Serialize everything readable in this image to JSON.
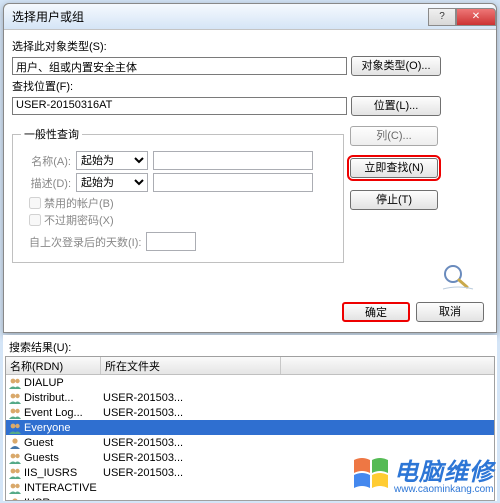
{
  "titlebar": {
    "text": "选择用户或组"
  },
  "labels": {
    "object_type": "选择此对象类型(S):",
    "object_type_val": "用户、组或内置安全主体",
    "object_type_btn": "对象类型(O)...",
    "location": "查找位置(F):",
    "location_val": "USER-20150316AT",
    "location_btn": "位置(L)...",
    "general_query": "一般性查询",
    "name": "名称(A):",
    "desc": "描述(D):",
    "starts_with": "起始为",
    "disabled_acct": "禁用的帐户(B)",
    "no_expire": "不过期密码(X)",
    "days_since": "自上次登录后的天数(I):",
    "columns_btn": "列(C)...",
    "find_now_btn": "立即查找(N)",
    "stop_btn": "停止(T)",
    "ok_btn": "确定",
    "cancel_btn": "取消",
    "results": "搜索结果(U):",
    "col_name": "名称(RDN)",
    "col_folder": "所在文件夹"
  },
  "results": [
    {
      "name": "DIALUP",
      "folder": "",
      "type": "group"
    },
    {
      "name": "Distribut...",
      "folder": "USER-201503...",
      "type": "group"
    },
    {
      "name": "Event Log...",
      "folder": "USER-201503...",
      "type": "group"
    },
    {
      "name": "Everyone",
      "folder": "",
      "type": "group",
      "selected": true
    },
    {
      "name": "Guest",
      "folder": "USER-201503...",
      "type": "user"
    },
    {
      "name": "Guests",
      "folder": "USER-201503...",
      "type": "group"
    },
    {
      "name": "IIS_IUSRS",
      "folder": "USER-201503...",
      "type": "group"
    },
    {
      "name": "INTERACTIVE",
      "folder": "",
      "type": "group"
    },
    {
      "name": "IUSR",
      "folder": "",
      "type": "user"
    }
  ],
  "brand": {
    "text": "电脑维修",
    "url": "www.caominkang.com"
  }
}
